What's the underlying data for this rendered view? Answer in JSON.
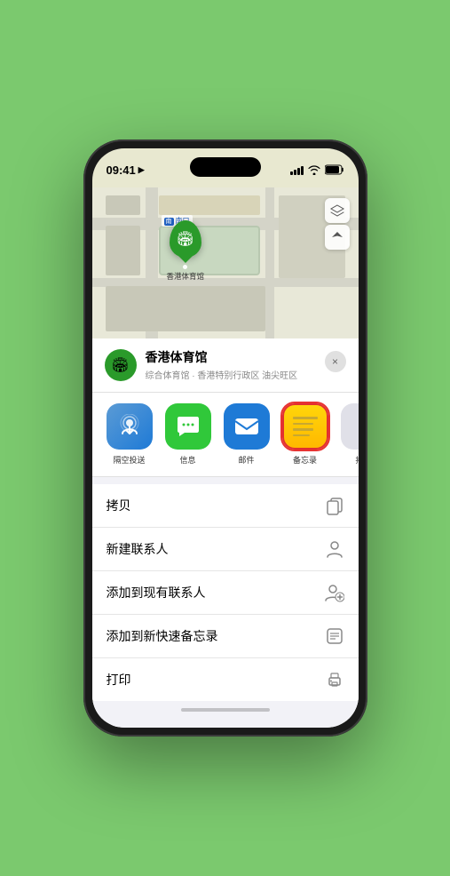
{
  "status_bar": {
    "time": "09:41",
    "location_icon": "▶"
  },
  "map": {
    "south_entrance_label": "南口",
    "south_entrance_prefix": "南",
    "stadium_label": "香港体育馆"
  },
  "map_controls": {
    "layers_icon": "🗺",
    "location_icon": "↗"
  },
  "venue": {
    "name": "香港体育馆",
    "subtitle": "综合体育馆 · 香港特别行政区 油尖旺区",
    "close_label": "×"
  },
  "share_items": [
    {
      "id": "airdrop",
      "label": "隔空投送",
      "icon": "wifi_rings"
    },
    {
      "id": "messages",
      "label": "信息",
      "icon": "bubble"
    },
    {
      "id": "mail",
      "label": "邮件",
      "icon": "envelope"
    },
    {
      "id": "notes",
      "label": "备忘录",
      "icon": "notepad"
    },
    {
      "id": "more",
      "label": "拷贝",
      "icon": "dots"
    }
  ],
  "action_items": [
    {
      "id": "copy",
      "label": "拷贝",
      "icon": "copy"
    },
    {
      "id": "new-contact",
      "label": "新建联系人",
      "icon": "person"
    },
    {
      "id": "add-existing",
      "label": "添加到现有联系人",
      "icon": "person-add"
    },
    {
      "id": "quick-note",
      "label": "添加到新快速备忘录",
      "icon": "note"
    },
    {
      "id": "print",
      "label": "打印",
      "icon": "print"
    }
  ],
  "home_bar": {}
}
